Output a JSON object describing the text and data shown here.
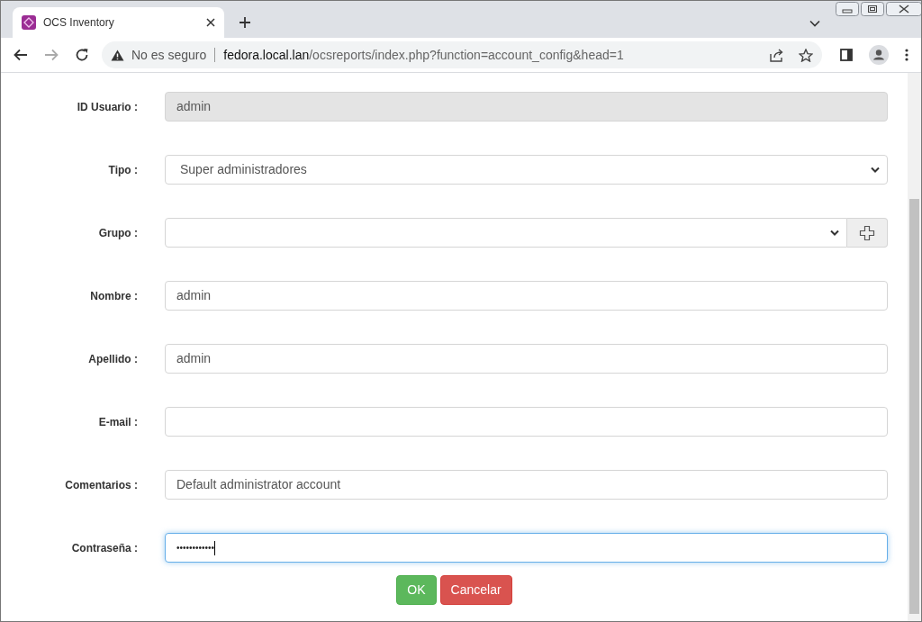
{
  "browser": {
    "tab": {
      "title": "OCS Inventory",
      "selected": true
    },
    "address": {
      "security": "No es seguro",
      "host": "fedora.local.lan",
      "path": "/ocsreports/index.php?function=account_config&head=1"
    }
  },
  "form": {
    "fields": [
      {
        "label": "ID Usuario :",
        "kind": "text",
        "value": "admin",
        "disabled": true,
        "focused": false
      },
      {
        "label": "Tipo :",
        "kind": "select",
        "value": "Super administradores",
        "disabled": false,
        "focused": false
      },
      {
        "label": "Grupo :",
        "kind": "select_add",
        "disabled": false,
        "focused": false
      },
      {
        "label": "Nombre :",
        "kind": "text",
        "value": "admin",
        "disabled": false,
        "focused": false
      },
      {
        "label": "Apellido :",
        "kind": "text",
        "value": "admin",
        "disabled": false,
        "focused": false
      },
      {
        "label": "E-mail :",
        "kind": "text",
        "disabled": false,
        "focused": false
      },
      {
        "label": "Comentarios :",
        "kind": "text",
        "value": "Default administrator account",
        "disabled": false,
        "focused": false
      },
      {
        "label": "Contraseña :",
        "kind": "password",
        "value": "••••••••••••",
        "disabled": false,
        "focused": true
      }
    ],
    "buttons": [
      {
        "label": "OK",
        "kind": "primary"
      },
      {
        "label": "Cancelar",
        "kind": "danger"
      }
    ]
  }
}
